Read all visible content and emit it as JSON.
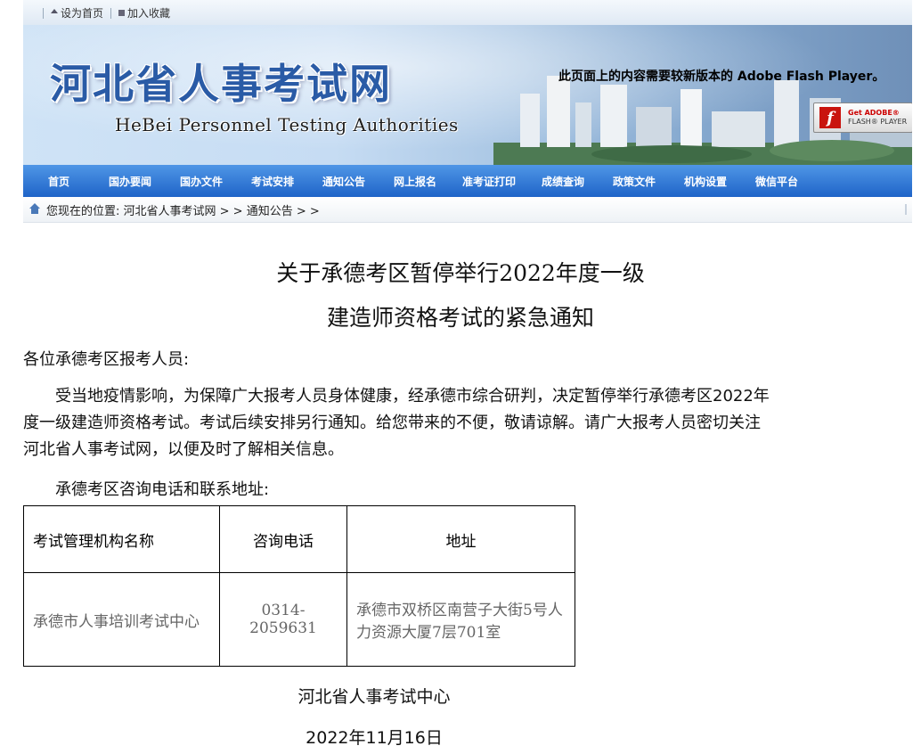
{
  "topbar": {
    "home_link": "设为首页",
    "fav_link": "加入收藏"
  },
  "banner": {
    "site_name_cn": "河北省人事考试网",
    "site_name_en": "HeBei Personnel Testing Authorities",
    "flash_message": "此页面上的内容需要较新版本的 Adobe Flash Player。",
    "flash_button": {
      "line1": "Get ADOBE®",
      "line2": "FLASH® PLAYER"
    }
  },
  "nav": {
    "items": [
      "首页",
      "国办要闻",
      "国办文件",
      "考试安排",
      "通知公告",
      "网上报名",
      "准考证打印",
      "成绩查询",
      "政策文件",
      "机构设置",
      "微信平台"
    ]
  },
  "breadcrumb": {
    "text": "您现在的位置: 河北省人事考试网 > > 通知公告 > >"
  },
  "article": {
    "title_line1": "关于承德考区暂停举行2022年度一级",
    "title_line2": "建造师资格考试的紧急通知",
    "salutation": "各位承德考区报考人员:",
    "body_line1": "　　受当地疫情影响，为保障广大报考人员身体健康，经承德市综合研判，决定暂停举行承德考区2022年",
    "body_line2": "度一级建造师资格考试。考试后续安排另行通知。给您带来的不便，敬请谅解。请广大报考人员密切关注",
    "body_line3": "河北省人事考试网，以便及时了解相关信息。",
    "contact_intro": "　　承德考区咨询电话和联系地址:",
    "table": {
      "headers": [
        "考试管理机构名称",
        "咨询电话",
        "地址"
      ],
      "row": {
        "org": "承德市人事培训考试中心",
        "phone": "0314-2059631",
        "address": "承德市双桥区南营子大街5号人力资源大厦7层701室"
      }
    },
    "issuer": "河北省人事考试中心",
    "date": "2022年11月16日"
  }
}
